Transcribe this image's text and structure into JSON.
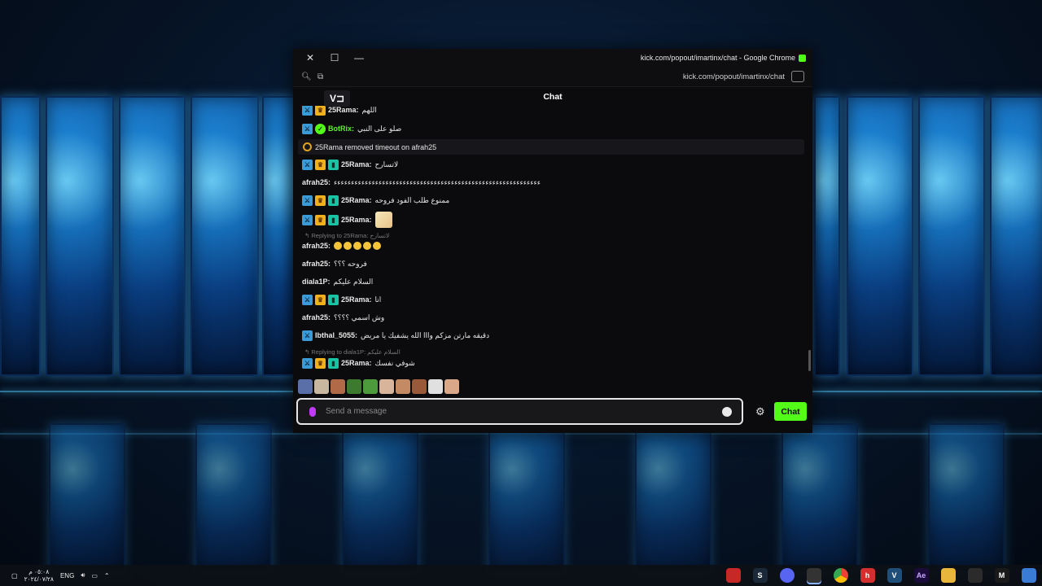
{
  "window": {
    "title": "kick.com/popout/imartinx/chat - Google Chrome",
    "url": "kick.com/popout/imartinx/chat",
    "close_glyph": "✕",
    "maximize_glyph": "☐",
    "minimize_glyph": "—"
  },
  "chat": {
    "header_title": "Chat",
    "logo_text": "V⊐",
    "messages": [
      {
        "user": "25Rama:",
        "text": "اللهم"
      },
      {
        "user": "BotRix:",
        "text": "صلو على النبي"
      },
      {
        "event": "25Rama removed timeout on afrah25"
      },
      {
        "user": "25Rama:",
        "text": "لاتسارح"
      },
      {
        "user": "afrah25:",
        "text": "ءءءءءءءءءءءءءءءءءءءءءءءءءءءءءءءءءءءءءءءءءءءءءءءءءءءءءءءءءءءء"
      },
      {
        "user": "25Rama:",
        "text": "ممنوع طلب الفود فروحه"
      },
      {
        "user": "25Rama:",
        "text": ""
      },
      {
        "reply": "Replying to 25Rama: لاتسارح"
      },
      {
        "user": "afrah25:",
        "text": ""
      },
      {
        "user": "afrah25:",
        "text": "فروحه ؟؟؟"
      },
      {
        "user": "diala1P:",
        "text": "السلام عليكم"
      },
      {
        "user": "25Rama:",
        "text": "انا"
      },
      {
        "user": "afrah25:",
        "text": "وش اسمي ؟؟؟؟"
      },
      {
        "user": "Ibthal_5055:",
        "text": "دقيقه مارتن مزكم وااا الله يشفيك يا مريض"
      },
      {
        "reply": "Replying to diala1P: السلام عليكم"
      },
      {
        "user": "25Rama:",
        "text": "شوفي نفسك"
      }
    ],
    "input_placeholder": "Send a message",
    "send_label": "Chat",
    "gear_glyph": "⚙"
  },
  "taskbar": {
    "lang": "ENG",
    "time": "٠٥:٠٨ م",
    "date": "٢٠٢٤/٠٧/٢٨"
  },
  "colors": {
    "kick_green": "#53fc18",
    "mod_badge": "#3b9bd8",
    "crown_badge": "#f2b11b",
    "sub_badge": "#19c4a5"
  }
}
